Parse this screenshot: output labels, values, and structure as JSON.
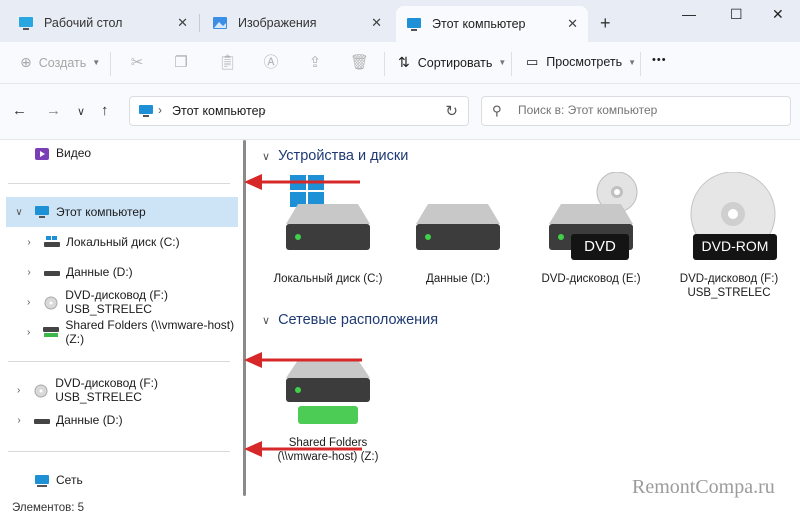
{
  "tabs": [
    {
      "label": "Рабочий стол",
      "icon": "desktop-icon"
    },
    {
      "label": "Изображения",
      "icon": "pictures-icon"
    },
    {
      "label": "Этот компьютер",
      "icon": "computer-icon"
    }
  ],
  "window_controls": {
    "minimize": "—",
    "maximize": "☐",
    "close": "✕"
  },
  "toolbar": {
    "create_label": "Создать",
    "sort_label": "Сортировать",
    "view_label": "Просмотреть",
    "more_label": "•••"
  },
  "address": {
    "path": "Этот компьютер"
  },
  "search": {
    "placeholder": "Поиск в: Этот компьютер"
  },
  "sidebar": {
    "items": [
      {
        "label": "Видео",
        "icon": "video-icon"
      },
      {
        "label": "Этот компьютер",
        "icon": "computer-icon"
      },
      {
        "label": "Локальный диск (C:)",
        "icon": "windows-drive-icon"
      },
      {
        "label": "Данные (D:)",
        "icon": "drive-icon"
      },
      {
        "label": "DVD-дисковод (F:) USB_STRELEC",
        "icon": "dvd-icon"
      },
      {
        "label": "Shared Folders (\\\\vmware-host) (Z:)",
        "icon": "network-drive-icon"
      },
      {
        "label": "DVD-дисковод (F:) USB_STRELEC",
        "icon": "dvd-icon"
      },
      {
        "label": "Данные (D:)",
        "icon": "drive-icon"
      },
      {
        "label": "Сеть",
        "icon": "network-icon"
      }
    ]
  },
  "content": {
    "groups": [
      {
        "title": "Устройства и диски"
      },
      {
        "title": "Сетевые расположения"
      }
    ],
    "drives": [
      {
        "label": "Локальный диск (C:)",
        "icon": "windows-drive-icon"
      },
      {
        "label": "Данные (D:)",
        "icon": "drive-icon"
      },
      {
        "label": "DVD-дисковод (E:)",
        "icon": "dvd-drive-icon",
        "badge": "DVD"
      },
      {
        "label": "DVD-дисковод (F:) USB_STRELEC",
        "icon": "dvd-rom-icon",
        "badge": "DVD-ROM"
      },
      {
        "label": "Shared Folders (\\\\vmware-host) (Z:)",
        "icon": "network-drive-icon"
      }
    ]
  },
  "status": {
    "text": "Элементов: 5"
  },
  "watermark": "RemontCompa.ru",
  "colors": {
    "accent": "#0067c0",
    "selection": "#cde4f7",
    "arrow": "#d62828"
  }
}
